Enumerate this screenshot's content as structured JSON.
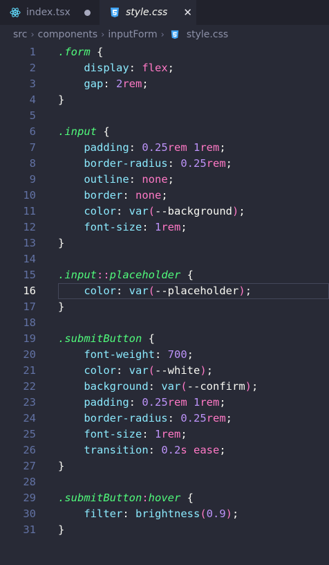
{
  "tabs": [
    {
      "label": "index.tsx",
      "icon": "react-icon",
      "dirty": true,
      "active": false
    },
    {
      "label": "style.css",
      "icon": "css-icon",
      "active": true
    }
  ],
  "breadcrumb": [
    "src",
    "components",
    "inputForm",
    "style.css"
  ],
  "current_line": 16,
  "colors": {
    "background": "#282a36",
    "selector": "#50fa7b",
    "property": "#8be9fd",
    "keyword": "#ff79c6",
    "number": "#bd93f9",
    "line_number": "#6272a4"
  },
  "code_lines": [
    [
      [
        "sel",
        ".form"
      ],
      [
        "pun",
        " {"
      ]
    ],
    [
      [
        "pun",
        "    "
      ],
      [
        "prop",
        "display"
      ],
      [
        "pun",
        ": "
      ],
      [
        "kw",
        "flex"
      ],
      [
        "pun",
        ";"
      ]
    ],
    [
      [
        "pun",
        "    "
      ],
      [
        "prop",
        "gap"
      ],
      [
        "pun",
        ": "
      ],
      [
        "num",
        "2"
      ],
      [
        "unit",
        "rem"
      ],
      [
        "pun",
        ";"
      ]
    ],
    [
      [
        "pun",
        "}"
      ]
    ],
    [],
    [
      [
        "sel",
        ".input"
      ],
      [
        "pun",
        " {"
      ]
    ],
    [
      [
        "pun",
        "    "
      ],
      [
        "prop",
        "padding"
      ],
      [
        "pun",
        ": "
      ],
      [
        "num",
        "0.25"
      ],
      [
        "unit",
        "rem"
      ],
      [
        "pun",
        " "
      ],
      [
        "num",
        "1"
      ],
      [
        "unit",
        "rem"
      ],
      [
        "pun",
        ";"
      ]
    ],
    [
      [
        "pun",
        "    "
      ],
      [
        "prop",
        "border-radius"
      ],
      [
        "pun",
        ": "
      ],
      [
        "num",
        "0.25"
      ],
      [
        "unit",
        "rem"
      ],
      [
        "pun",
        ";"
      ]
    ],
    [
      [
        "pun",
        "    "
      ],
      [
        "prop",
        "outline"
      ],
      [
        "pun",
        ": "
      ],
      [
        "kw",
        "none"
      ],
      [
        "pun",
        ";"
      ]
    ],
    [
      [
        "pun",
        "    "
      ],
      [
        "prop",
        "border"
      ],
      [
        "pun",
        ": "
      ],
      [
        "kw",
        "none"
      ],
      [
        "pun",
        ";"
      ]
    ],
    [
      [
        "pun",
        "    "
      ],
      [
        "prop",
        "color"
      ],
      [
        "pun",
        ": "
      ],
      [
        "fn",
        "var"
      ],
      [
        "kw",
        "("
      ],
      [
        "txt",
        "--background"
      ],
      [
        "kw",
        ")"
      ],
      [
        "pun",
        ";"
      ]
    ],
    [
      [
        "pun",
        "    "
      ],
      [
        "prop",
        "font-size"
      ],
      [
        "pun",
        ": "
      ],
      [
        "num",
        "1"
      ],
      [
        "unit",
        "rem"
      ],
      [
        "pun",
        ";"
      ]
    ],
    [
      [
        "pun",
        "}"
      ]
    ],
    [],
    [
      [
        "sel",
        ".input"
      ],
      [
        "pseudo",
        "::"
      ],
      [
        "sel",
        "placeholder"
      ],
      [
        "pun",
        " {"
      ]
    ],
    [
      [
        "pun",
        "    "
      ],
      [
        "prop",
        "color"
      ],
      [
        "pun",
        ": "
      ],
      [
        "fn",
        "var"
      ],
      [
        "kw",
        "("
      ],
      [
        "txt",
        "--placeholder"
      ],
      [
        "kw",
        ")"
      ],
      [
        "pun",
        ";"
      ]
    ],
    [
      [
        "pun",
        "}"
      ]
    ],
    [],
    [
      [
        "sel",
        ".submitButton"
      ],
      [
        "pun",
        " {"
      ]
    ],
    [
      [
        "pun",
        "    "
      ],
      [
        "prop",
        "font-weight"
      ],
      [
        "pun",
        ": "
      ],
      [
        "num",
        "700"
      ],
      [
        "pun",
        ";"
      ]
    ],
    [
      [
        "pun",
        "    "
      ],
      [
        "prop",
        "color"
      ],
      [
        "pun",
        ": "
      ],
      [
        "fn",
        "var"
      ],
      [
        "kw",
        "("
      ],
      [
        "txt",
        "--white"
      ],
      [
        "kw",
        ")"
      ],
      [
        "pun",
        ";"
      ]
    ],
    [
      [
        "pun",
        "    "
      ],
      [
        "prop",
        "background"
      ],
      [
        "pun",
        ": "
      ],
      [
        "fn",
        "var"
      ],
      [
        "kw",
        "("
      ],
      [
        "txt",
        "--confirm"
      ],
      [
        "kw",
        ")"
      ],
      [
        "pun",
        ";"
      ]
    ],
    [
      [
        "pun",
        "    "
      ],
      [
        "prop",
        "padding"
      ],
      [
        "pun",
        ": "
      ],
      [
        "num",
        "0.25"
      ],
      [
        "unit",
        "rem"
      ],
      [
        "pun",
        " "
      ],
      [
        "num",
        "1"
      ],
      [
        "unit",
        "rem"
      ],
      [
        "pun",
        ";"
      ]
    ],
    [
      [
        "pun",
        "    "
      ],
      [
        "prop",
        "border-radius"
      ],
      [
        "pun",
        ": "
      ],
      [
        "num",
        "0.25"
      ],
      [
        "unit",
        "rem"
      ],
      [
        "pun",
        ";"
      ]
    ],
    [
      [
        "pun",
        "    "
      ],
      [
        "prop",
        "font-size"
      ],
      [
        "pun",
        ": "
      ],
      [
        "num",
        "1"
      ],
      [
        "unit",
        "rem"
      ],
      [
        "pun",
        ";"
      ]
    ],
    [
      [
        "pun",
        "    "
      ],
      [
        "prop",
        "transition"
      ],
      [
        "pun",
        ": "
      ],
      [
        "num",
        "0.2"
      ],
      [
        "unit",
        "s"
      ],
      [
        "pun",
        " "
      ],
      [
        "kw",
        "ease"
      ],
      [
        "pun",
        ";"
      ]
    ],
    [
      [
        "pun",
        "}"
      ]
    ],
    [],
    [
      [
        "sel",
        ".submitButton"
      ],
      [
        "pseudo",
        ":"
      ],
      [
        "sel",
        "hover"
      ],
      [
        "pun",
        " {"
      ]
    ],
    [
      [
        "pun",
        "    "
      ],
      [
        "prop",
        "filter"
      ],
      [
        "pun",
        ": "
      ],
      [
        "fn",
        "brightness"
      ],
      [
        "kw",
        "("
      ],
      [
        "num",
        "0.9"
      ],
      [
        "kw",
        ")"
      ],
      [
        "pun",
        ";"
      ]
    ],
    [
      [
        "pun",
        "}"
      ]
    ]
  ]
}
